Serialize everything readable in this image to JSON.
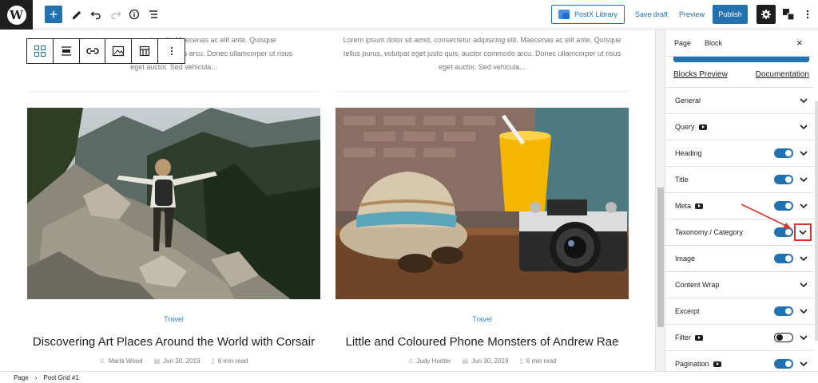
{
  "topbar": {
    "postx_label": "PostX Library",
    "save_draft_label": "Save draft",
    "preview_label": "Preview",
    "publish_label": "Publish"
  },
  "canvas": {
    "excerpt_left": "Lorem ipsum dolor sit amet, consectetur adipiscing elit. Maecenas ac elit ante. Quisque tellus purus, volutpat eget justo quis, auctor commodo arcu. Donec ullamcorper ut risus eget auctor. Sed vehicula...",
    "excerpt_left_line1": "cing elit. Maecenas ac elit ante. Quisque",
    "excerpt_left_line2": "mmodo arcu. Donec ullamcorper ut risus",
    "excerpt_left_line3": "eget auctor. Sed vehicula...",
    "excerpt_right_line1": "Lorem ipsum dolor sit amet, consectetur adipiscing elit. Maecenas ac elit ante. Quisque",
    "excerpt_right_line2": "tellus purus, volutpat eget justo quis, auctor commodo arcu. Donec ullamcorper ut risus",
    "excerpt_right_line3": "eget auctor. Sed vehicula...",
    "posts": [
      {
        "category": "Travel",
        "title": "Discovering Art Places Around the World with Corsair",
        "author": "Maria Wood",
        "date": "Jun 30, 2019",
        "read_time": "6 min read"
      },
      {
        "category": "Travel",
        "title": "Little and Coloured Phone Monsters of Andrew Rae",
        "author": "Judy Hunter",
        "date": "Jun 30, 2019",
        "read_time": "6 min read"
      }
    ]
  },
  "sidebar": {
    "tab_page": "Page",
    "tab_block": "Block",
    "close_icon": "×",
    "blocks_preview": "Blocks Preview",
    "documentation": "Documentation",
    "panels": [
      {
        "label": "General"
      },
      {
        "label": "Query"
      },
      {
        "label": "Heading"
      },
      {
        "label": "Title"
      },
      {
        "label": "Meta"
      },
      {
        "label": "Taxonomy / Category"
      },
      {
        "label": "Image"
      },
      {
        "label": "Content Wrap"
      },
      {
        "label": "Excerpt"
      },
      {
        "label": "Filter"
      },
      {
        "label": "Pagination"
      }
    ]
  },
  "breadcrumb": {
    "root": "Page",
    "current": "Post Grid #1"
  },
  "colors": {
    "accent": "#2271b1",
    "highlight": "#e0312b",
    "category": "#2a8be0"
  }
}
